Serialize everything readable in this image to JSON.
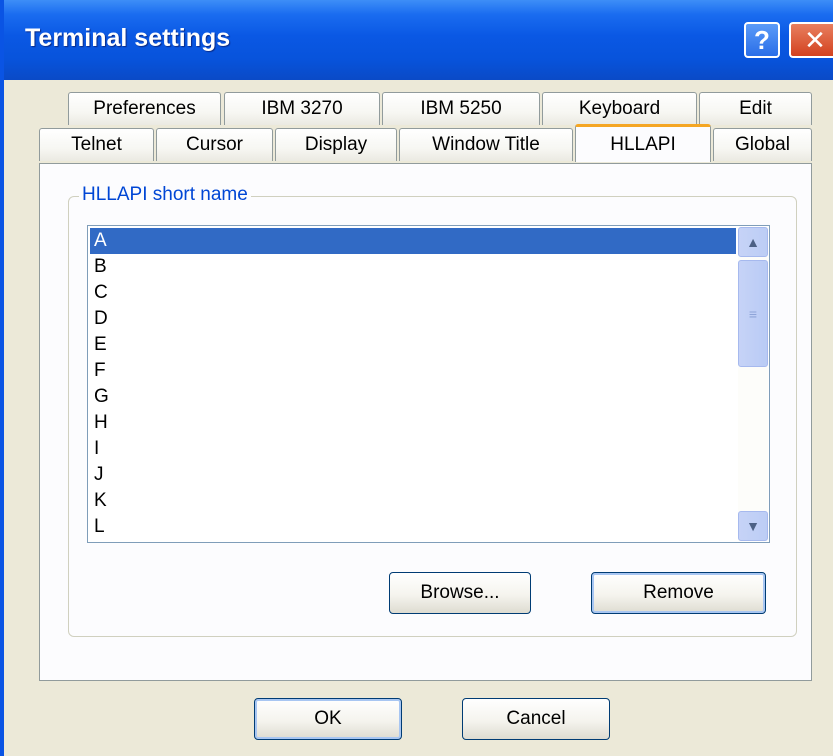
{
  "window": {
    "title": "Terminal settings"
  },
  "titlebar_buttons": {
    "help": "?",
    "close": "✕"
  },
  "tabs": {
    "row1": [
      "Preferences",
      "IBM 3270",
      "IBM 5250",
      "Keyboard",
      "Edit"
    ],
    "row2": [
      "Telnet",
      "Cursor",
      "Display",
      "Window Title",
      "HLLAPI",
      "Global"
    ],
    "active": "HLLAPI"
  },
  "hllapi": {
    "group_label": "HLLAPI short name",
    "items": [
      "A",
      "B",
      "C",
      "D",
      "E",
      "F",
      "G",
      "H",
      "I",
      "J",
      "K",
      "L"
    ],
    "selected": "A",
    "browse_label": "Browse...",
    "remove_label": "Remove"
  },
  "footer": {
    "ok_label": "OK",
    "cancel_label": "Cancel"
  },
  "icons": {
    "scroll_up": "▲",
    "scroll_down": "▼",
    "thumb_grip": "≡"
  },
  "colors": {
    "titlebar": "#0a58e4",
    "selection": "#316ac5",
    "group_label": "#0046d5",
    "active_tab_accent": "#f5a623"
  }
}
